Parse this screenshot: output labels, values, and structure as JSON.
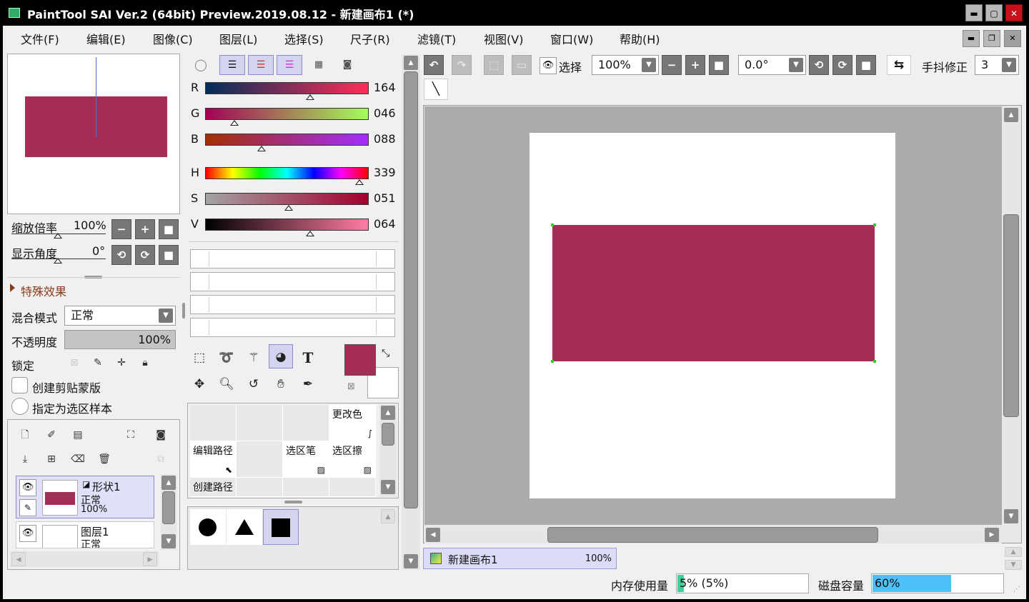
{
  "window": {
    "title": "PaintTool SAI Ver.2 (64bit) Preview.2019.08.12 - 新建画布1 (*)",
    "minimize": "▬",
    "maximize": "▢",
    "close": "✕"
  },
  "menu": [
    "文件(F)",
    "编辑(E)",
    "图像(C)",
    "图层(L)",
    "选择(S)",
    "尺子(R)",
    "滤镜(T)",
    "视图(V)",
    "窗口(W)",
    "帮助(H)"
  ],
  "navigator": {
    "zoom_label": "缩放倍率",
    "zoom_value": "100%",
    "angle_label": "显示角度",
    "angle_value": "0°"
  },
  "effects": {
    "label": "特殊效果"
  },
  "layer_props": {
    "blend_label": "混合模式",
    "blend_value": "正常",
    "opacity_label": "不透明度",
    "opacity_value": "100%",
    "lock_label": "锁定",
    "clipping_label": "创建剪贴蒙版",
    "selection_source_label": "指定为选区样本"
  },
  "layers": [
    {
      "name": "形状1",
      "mode": "正常",
      "opacity": "100%"
    },
    {
      "name": "图层1",
      "mode": "正常"
    }
  ],
  "color": {
    "R": "164",
    "G": "046",
    "B": "088",
    "H": "339",
    "S": "051",
    "V": "064",
    "current_hex": "#a42e58",
    "r_level": 0.643,
    "g_level": 0.18,
    "b_level": 0.345,
    "h_level": 0.942,
    "s_level": 0.51,
    "v_level": 0.64
  },
  "tool_grid": {
    "cells": [
      "",
      "",
      "",
      "更改色",
      "编辑路径",
      "",
      "选区笔",
      "选区擦",
      "创建路径",
      "",
      "",
      ""
    ]
  },
  "toolbar": {
    "select_label": "选择",
    "zoom": "100%",
    "rotation": "0.0°",
    "stabilizer_label": "手抖修正",
    "stabilizer_value": "3"
  },
  "canvas_tab": {
    "name": "新建画布1",
    "zoom": "100%"
  },
  "status": {
    "memory_label": "内存使用量",
    "memory_value": "5% (5%)",
    "memory_level": 0.05,
    "disk_label": "磁盘容量",
    "disk_value": "60%",
    "disk_level": 0.6
  }
}
